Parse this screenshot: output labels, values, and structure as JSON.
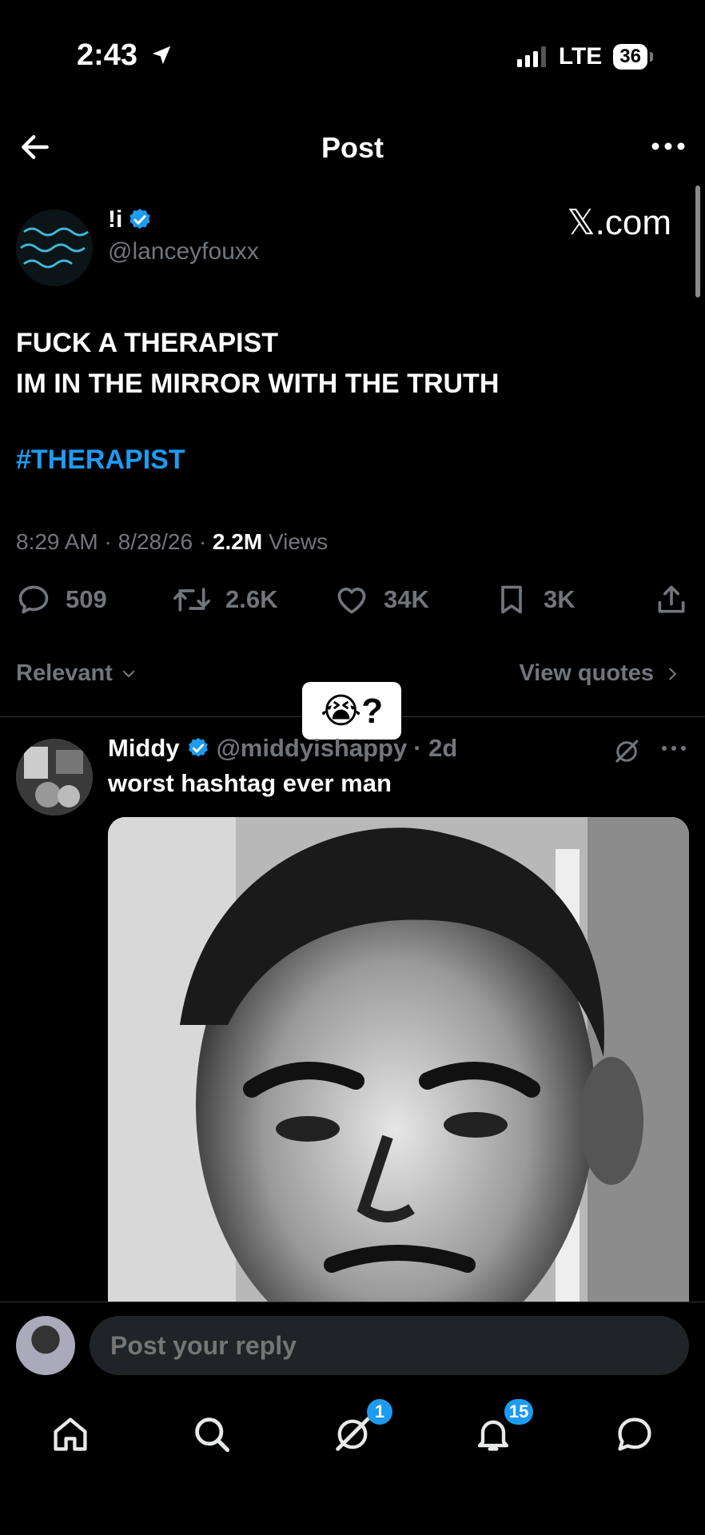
{
  "status_bar": {
    "time": "2:43",
    "network": "LTE",
    "battery": "36"
  },
  "header": {
    "title": "Post"
  },
  "post": {
    "author_name": "!i",
    "author_handle": "@lanceyfouxx",
    "watermark": "𝕏.com",
    "text": "FUCK A THERAPIST\nIM IN THE MIRROR WITH THE TRUTH",
    "hashtag": "#THERAPIST",
    "timestamp": "8:29 AM · 8/28/26 · ",
    "views_count": "2.2M",
    "views_label": " Views",
    "actions": {
      "replies": "509",
      "reposts": "2.6K",
      "likes": "34K",
      "bookmarks": "3K"
    }
  },
  "sort": {
    "label": "Relevant",
    "view_quotes": "View quotes"
  },
  "sticker": {
    "text": "😭?"
  },
  "reply": {
    "name": "Middy",
    "handle": "@middyishappy",
    "age": "· 2d",
    "text": "worst hashtag ever man"
  },
  "composer": {
    "placeholder": "Post your reply"
  },
  "tabs": {
    "messages_badge": "1",
    "notifications_badge": "15"
  },
  "colors": {
    "accent": "#1d9bf0",
    "muted": "#71767b",
    "background": "#000000"
  }
}
